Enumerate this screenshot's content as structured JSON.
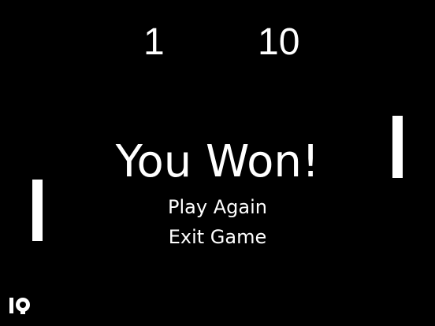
{
  "scoreboard": {
    "left_score": "1",
    "right_score": "10"
  },
  "result": {
    "title": "You Won!"
  },
  "menu": {
    "play_again_label": "Play Again",
    "exit_game_label": "Exit Game"
  },
  "colors": {
    "background": "#000000",
    "foreground": "#ffffff"
  },
  "icons": {
    "corner_logo": "game-logo-icon"
  }
}
